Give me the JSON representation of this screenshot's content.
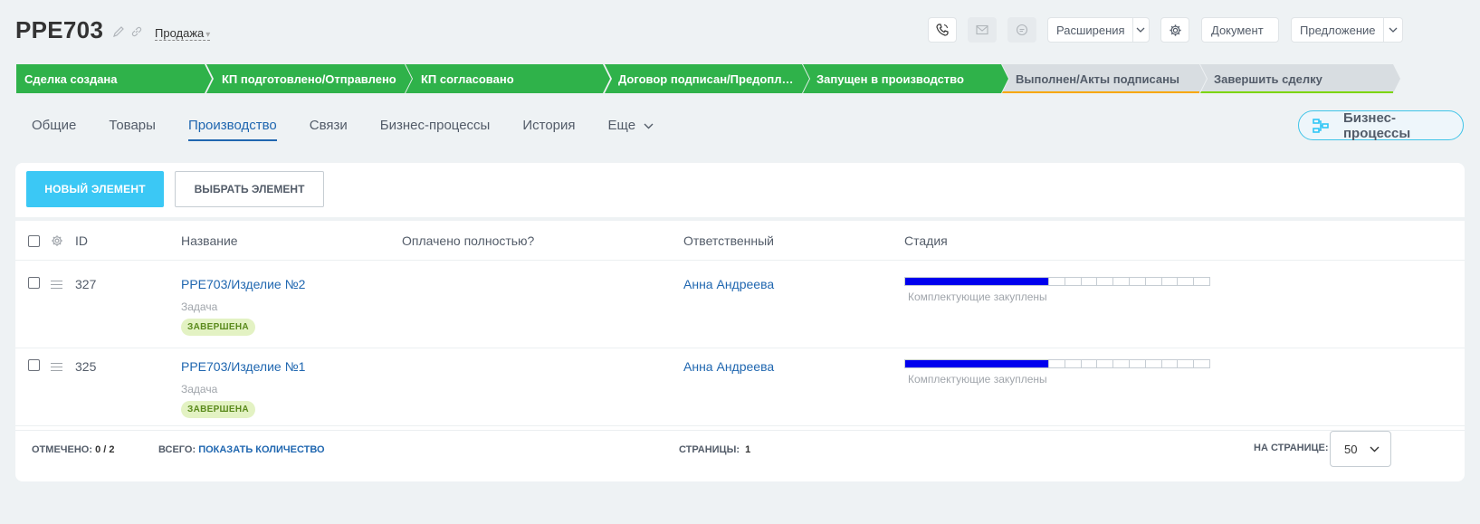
{
  "header": {
    "title": "PPE703",
    "type_label": "Продажа",
    "extensions_label": "Расширения",
    "document_label": "Документ",
    "proposal_label": "Предложение"
  },
  "stages": [
    {
      "label": "Сделка создана",
      "state": "done"
    },
    {
      "label": "КП подготовлено/Отправлено",
      "state": "done"
    },
    {
      "label": "КП согласовано",
      "state": "done"
    },
    {
      "label": "Договор подписан/Предоплат...",
      "state": "done"
    },
    {
      "label": "Запущен в производство",
      "state": "done"
    },
    {
      "label": "Выполнен/Акты подписаны",
      "state": "pending",
      "accent": "#f7a700"
    },
    {
      "label": "Завершить сделку",
      "state": "pending",
      "accent": "#7bd500"
    }
  ],
  "tabs": [
    {
      "label": "Общие"
    },
    {
      "label": "Товары"
    },
    {
      "label": "Производство",
      "active": true
    },
    {
      "label": "Связи"
    },
    {
      "label": "Бизнес-процессы"
    },
    {
      "label": "История"
    },
    {
      "label": "Еще"
    }
  ],
  "bp_button_label": "Бизнес-процессы",
  "toolbar": {
    "new_label": "НОВЫЙ ЭЛЕМЕНТ",
    "select_label": "ВЫБРАТЬ ЭЛЕМЕНТ"
  },
  "grid": {
    "columns": {
      "id": "ID",
      "name": "Название",
      "paid": "Оплачено полностью?",
      "responsible": "Ответственный",
      "stage": "Стадия"
    },
    "rows": [
      {
        "id": "327",
        "name": "PPE703/Изделие №2",
        "type": "Задача",
        "status": "ЗАВЕРШЕНА",
        "responsible": "Анна Андреева",
        "stage": "Комплектующие закуплены",
        "progress": 0.47
      },
      {
        "id": "325",
        "name": "PPE703/Изделие №1",
        "type": "Задача",
        "status": "ЗАВЕРШЕНА",
        "responsible": "Анна Андреева",
        "stage": "Комплектующие закуплены",
        "progress": 0.47
      }
    ]
  },
  "footer": {
    "selected_label": "ОТМЕЧЕНО:",
    "selected_value": "0 / 2",
    "total_label": "ВСЕГО:",
    "total_link": "ПОКАЗАТЬ КОЛИЧЕСТВО",
    "pages_label": "СТРАНИЦЫ:",
    "pages_value": "1",
    "per_page_label": "НА СТРАНИЦЕ:",
    "per_page_value": "50"
  }
}
